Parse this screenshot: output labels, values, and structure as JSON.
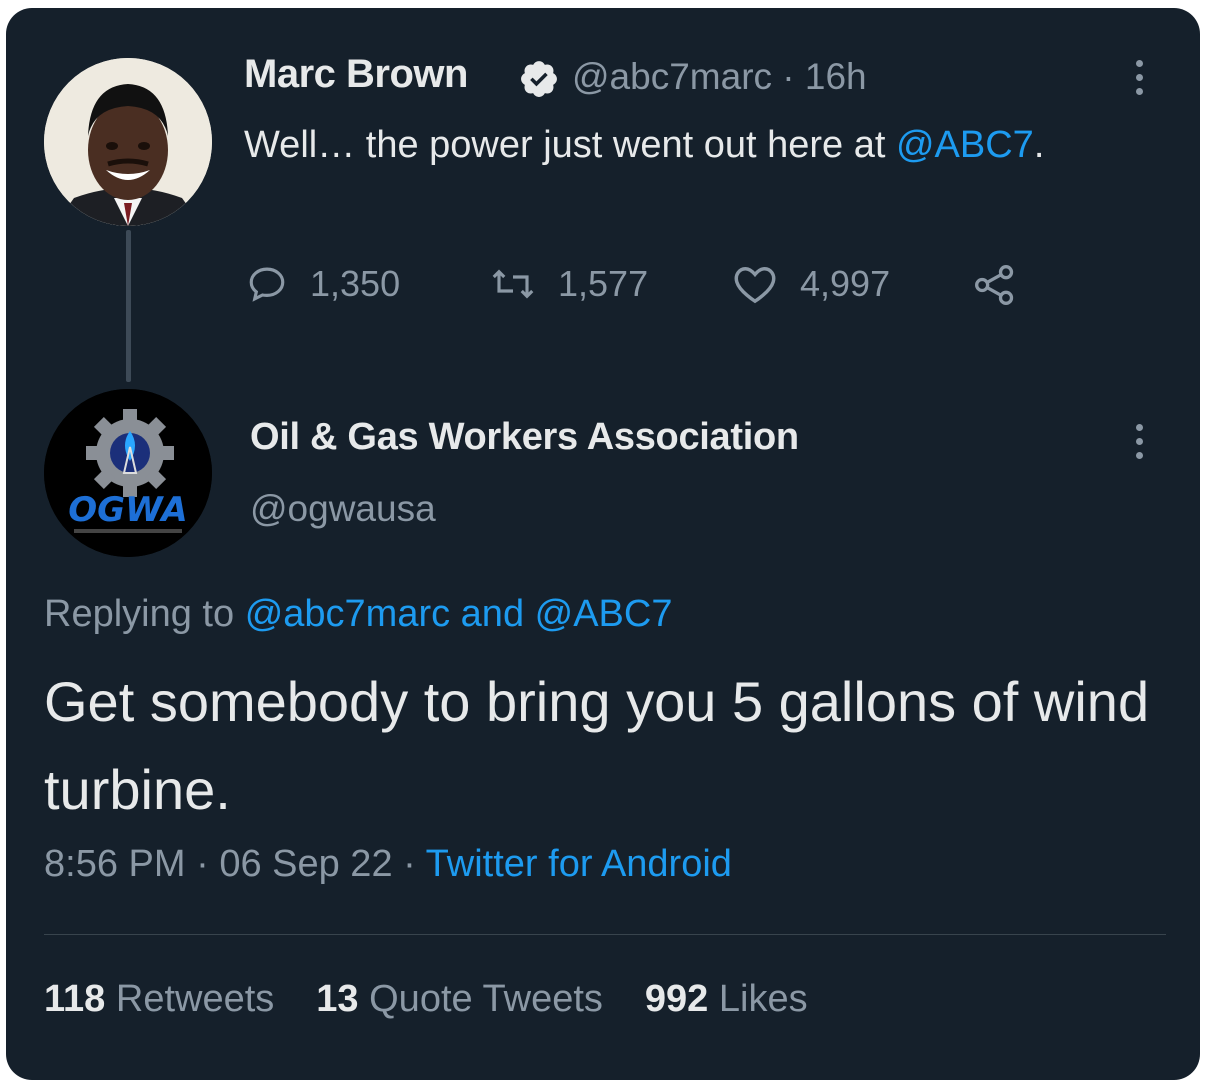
{
  "original_tweet": {
    "author_name": "Marc Brown",
    "verified": true,
    "handle": "@abc7marc",
    "separator": "·",
    "time_ago": "16h",
    "text_prefix": "Well… the power just went out here at ",
    "mention": "@ABC7",
    "text_suffix": ".",
    "actions": {
      "reply_count": "1,350",
      "retweet_count": "1,577",
      "like_count": "4,997"
    },
    "icons": [
      "reply-icon",
      "retweet-icon",
      "like-icon",
      "share-icon",
      "more-icon"
    ]
  },
  "reply_tweet": {
    "author_name": "Oil & Gas Workers Association",
    "handle": "@ogwausa",
    "replying_label": "Replying to",
    "replying_to_1": "@abc7marc",
    "replying_and": "and",
    "replying_to_2": "@ABC7",
    "text": "Get somebody to bring you 5 gallons of wind turbine.",
    "time": "8:56 PM",
    "date": "06 Sep 22",
    "source": "Twitter for Android",
    "dot": "·",
    "logo_text": "OGWA",
    "stats": {
      "retweets_count": "118",
      "retweets_label": "Retweets",
      "quotes_count": "13",
      "quotes_label": "Quote Tweets",
      "likes_count": "992",
      "likes_label": "Likes"
    }
  },
  "colors": {
    "background": "#15202b",
    "text": "#e7e9ea",
    "secondary": "#8b98a5",
    "accent": "#1d9bf0"
  }
}
